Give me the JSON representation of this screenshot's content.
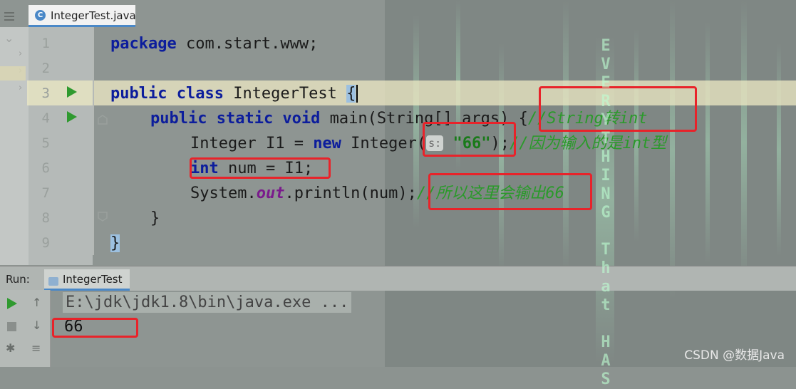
{
  "editor": {
    "tab_label": "IntegerTest.java",
    "tab_icon_glyph": "C",
    "line_numbers": [
      "1",
      "2",
      "3",
      "4",
      "5",
      "6",
      "7",
      "8",
      "9"
    ],
    "lines": {
      "l1_kw": "package",
      "l1_rest": " com.start.www;",
      "l3_kw": "public class",
      "l3_rest": " IntegerTest ",
      "l3_brace": "{",
      "l4_kw": "public static void",
      "l4_rest": " main(String[] args) ",
      "l4_brace": "{",
      "l4_comment": "//String转int",
      "l5_pre": "Integer I1 = ",
      "l5_kw": "new",
      "l5_mid": " Integer(",
      "l5_hint": "s:",
      "l5_str": "\"66\"",
      "l5_post": ");",
      "l5_comment": "//因为输入的是int型",
      "l6_kw": "int",
      "l6_rest": " num = I1;",
      "l7_pre": "System.",
      "l7_field": "out",
      "l7_post": ".println(num);",
      "l7_comment": "//所以这里会输出66",
      "l8": "}",
      "l9": "}"
    }
  },
  "run_panel": {
    "title": "Run:",
    "tab_label": "IntegerTest",
    "command": "E:\\jdk\\jdk1.8\\bin\\java.exe ...",
    "output": "66"
  },
  "watermark": "CSDN @数据Java",
  "colors": {
    "highlight_box": "#e8232a",
    "keyword": "#0c1d9c",
    "comment": "#2a9a2a",
    "string": "#1a7a1a",
    "run_green": "#2f9a2f"
  }
}
